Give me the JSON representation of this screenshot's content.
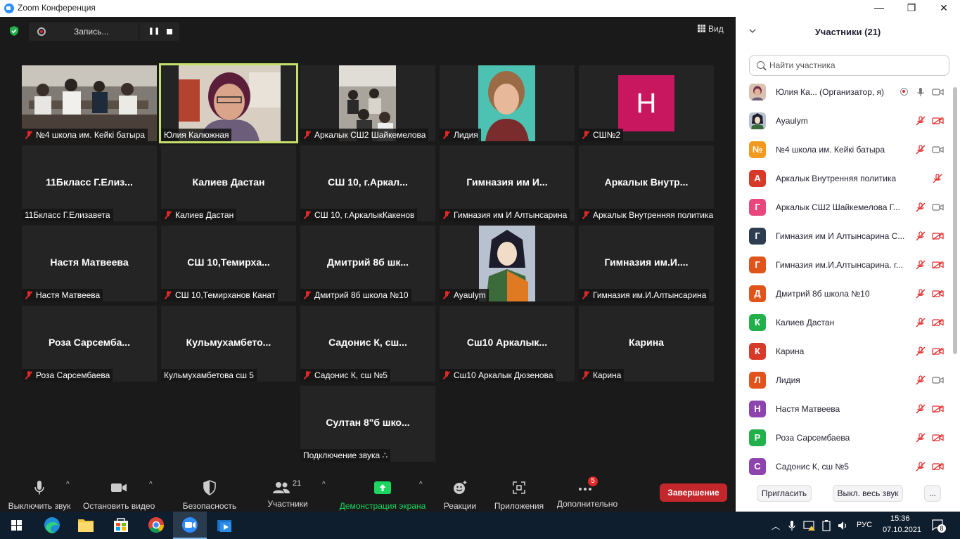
{
  "window": {
    "title": "Zoom Конференция",
    "minimize": "—",
    "maximize": "❐",
    "close": "✕"
  },
  "recording": {
    "label": "Запись...",
    "pause": "❚❚"
  },
  "view_label": "Вид",
  "tiles": [
    {
      "label": "№4 школа им. Кейкі батыра",
      "big": "",
      "muted": true,
      "kind": "photo-class"
    },
    {
      "label": "Юлия Калюжная",
      "big": "",
      "muted": false,
      "kind": "photo-host",
      "active": true
    },
    {
      "label": "Аркалык СШ2 Шайкемелова",
      "big": "",
      "muted": true,
      "kind": "photo-class2"
    },
    {
      "label": "Лидия",
      "big": "",
      "muted": true,
      "kind": "photo-girl"
    },
    {
      "label": "СШ№2",
      "big": "",
      "muted": true,
      "kind": "avatar",
      "letter": "Н"
    },
    {
      "label": "11Бкласс Г.Елизавета",
      "big": "11Бкласс Г.Елиз...",
      "muted": false
    },
    {
      "label": "Калиев Дастан",
      "big": "Калиев Дастан",
      "muted": true
    },
    {
      "label": "СШ 10, г.АркалыкКакенов",
      "big": "СШ 10, г.Аркал...",
      "muted": true
    },
    {
      "label": "Гимназия им И Алтынсарина",
      "big": "Гимназия им И...",
      "muted": true
    },
    {
      "label": "Аркалык Внутренняя политика",
      "big": "Аркалык Внутр...",
      "muted": true
    },
    {
      "label": "Настя Матвеева",
      "big": "Настя Матвеева",
      "muted": true
    },
    {
      "label": "СШ 10,Темирханов Канат",
      "big": "СШ 10,Темирха...",
      "muted": true
    },
    {
      "label": "Дмитрий 8б школа №10",
      "big": "Дмитрий 8б шк...",
      "muted": true
    },
    {
      "label": "Ayaulym",
      "big": "",
      "muted": true,
      "kind": "photo-anime"
    },
    {
      "label": "Гимназия им.И.Алтынсарина",
      "big": "Гимназия им.И....",
      "muted": true
    },
    {
      "label": "Роза Сарсембаева",
      "big": "Роза Сарсемба...",
      "muted": true
    },
    {
      "label": "Кульмухамбетова сш 5",
      "big": "Кульмухамбето...",
      "muted": false
    },
    {
      "label": "Садонис К, сш №5",
      "big": "Садонис К, сш...",
      "muted": true
    },
    {
      "label": "Сш10 Аркалык Дюзенова",
      "big": "Сш10 Аркалык...",
      "muted": true
    },
    {
      "label": "Карина",
      "big": "Карина",
      "muted": true
    },
    {
      "label": "Подключение звука ∴",
      "big": "Султан 8\"б шко...",
      "muted": false
    }
  ],
  "toolbar": {
    "mute": "Выключить звук",
    "video": "Остановить видео",
    "security": "Безопасность",
    "participants": "Участники",
    "participants_count": "21",
    "share": "Демонстрация экрана",
    "reactions": "Реакции",
    "apps": "Приложения",
    "more": "Дополнительно",
    "more_badge": "5",
    "end": "Завершение"
  },
  "panel": {
    "title": "Участники (21)",
    "search_placeholder": "Найти участника",
    "participants": [
      {
        "name": "Юлия Ка...  (Организатор, я)",
        "initial": "",
        "color": "#8a6b5a",
        "mic": "on",
        "cam": "on",
        "rec": true
      },
      {
        "name": "Ayaulym",
        "initial": "",
        "color": "#3a3f5a",
        "mic": "off",
        "cam": "off"
      },
      {
        "name": "№4 школа им. Кейкі батыра",
        "initial": "№",
        "color": "#f29a1f",
        "mic": "off",
        "cam": "on"
      },
      {
        "name": "Аркалык Внутренняя политика",
        "initial": "А",
        "color": "#d83a2a",
        "mic": "off",
        "cam": "none"
      },
      {
        "name": "Аркалык СШ2 Шайкемелова Г...",
        "initial": "Г",
        "color": "#e8467c",
        "mic": "off",
        "cam": "on"
      },
      {
        "name": "Гимназия им И Алтынсарина С...",
        "initial": "Г",
        "color": "#2c3e50",
        "mic": "off",
        "cam": "off"
      },
      {
        "name": "Гимназия им.И.Алтынсарина. г...",
        "initial": "Г",
        "color": "#e0541b",
        "mic": "off",
        "cam": "off"
      },
      {
        "name": "Дмитрий 8б школа №10",
        "initial": "Д",
        "color": "#e0541b",
        "mic": "off",
        "cam": "off"
      },
      {
        "name": "Калиев Дастан",
        "initial": "К",
        "color": "#22b04b",
        "mic": "off",
        "cam": "off"
      },
      {
        "name": "Карина",
        "initial": "К",
        "color": "#d83a2a",
        "mic": "off",
        "cam": "off"
      },
      {
        "name": "Лидия",
        "initial": "Л",
        "color": "#e0541b",
        "mic": "off",
        "cam": "on"
      },
      {
        "name": "Настя Матвеева",
        "initial": "Н",
        "color": "#8e44ad",
        "mic": "off",
        "cam": "off"
      },
      {
        "name": "Роза Сарсембаева",
        "initial": "Р",
        "color": "#22b04b",
        "mic": "off",
        "cam": "off"
      },
      {
        "name": "Садонис К, сш №5",
        "initial": "С",
        "color": "#8e44ad",
        "mic": "off",
        "cam": "off"
      }
    ],
    "invite": "Пригласить",
    "mute_all": "Выкл. весь звук",
    "more": "..."
  },
  "taskbar": {
    "lang": "РУС",
    "time": "15:36",
    "date": "07.10.2021",
    "notifications": "8"
  }
}
